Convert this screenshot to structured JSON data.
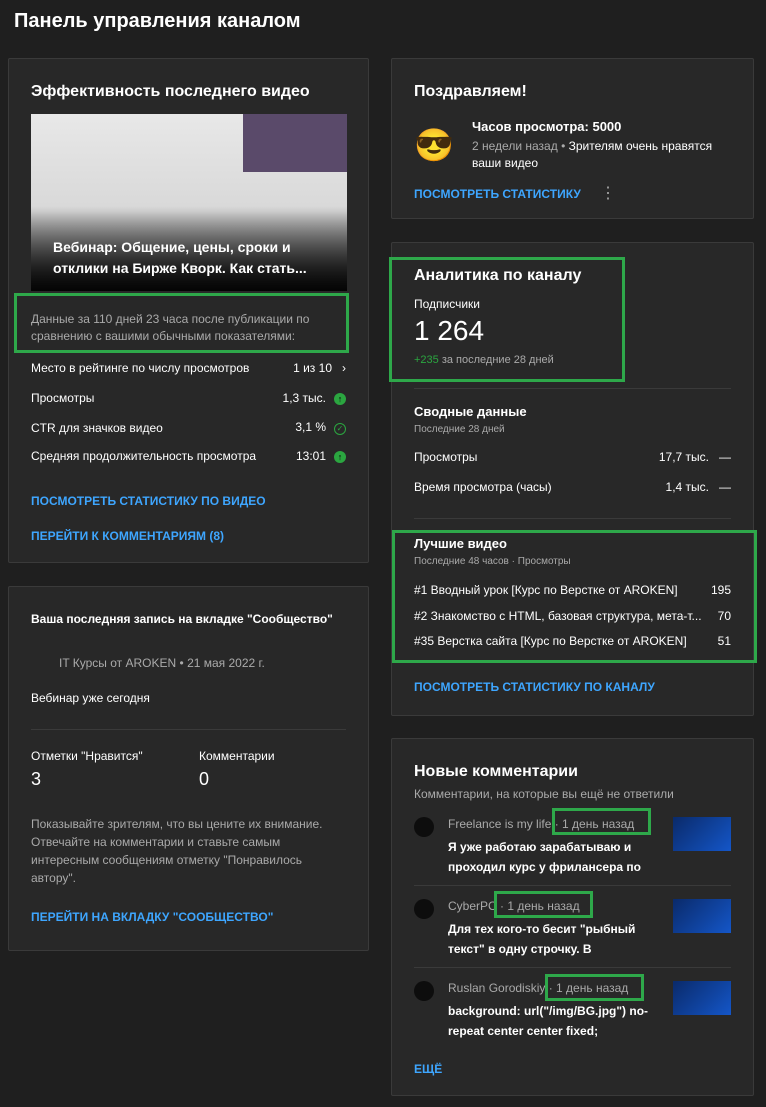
{
  "page_title": "Панель управления каналом",
  "last_video": {
    "heading": "Эффективность последнего видео",
    "video_title": "Вебинар: Общение, цены, сроки и отклики на Бирже Кворк. Как стать...",
    "note": "Данные за 110 дней 23 часа после публикации по сравнению с вашими обычными показателями:",
    "metrics": [
      {
        "label": "Место в рейтинге по числу просмотров",
        "value": "1 из 10"
      },
      {
        "label": "Просмотры",
        "value": "1,3 тыс."
      },
      {
        "label": "CTR для значков видео",
        "value": "3,1 %"
      },
      {
        "label": "Средняя продолжительность просмотра",
        "value": "13:01"
      }
    ],
    "link_stats": "ПОСМОТРЕТЬ СТАТИСТИКУ ПО ВИДЕО",
    "link_comments": "ПЕРЕЙТИ К КОММЕНТАРИЯМ (8)"
  },
  "community": {
    "heading": "Ваша последняя запись на вкладке \"Сообщество\"",
    "author": "IT Курсы от AROKEN",
    "date": "21 мая 2022 г.",
    "post": "Вебинар уже сегодня",
    "likes_label": "Отметки \"Нравится\"",
    "likes": "3",
    "comments_label": "Комментарии",
    "comments": "0",
    "tip": "Показывайте зрителям, что вы цените их внимание. Отвечайте на комментарии и ставьте самым интересным сообщениям отметку \"Понравилось автору\".",
    "link": "ПЕРЕЙТИ НА ВКЛАДКУ \"СООБЩЕСТВО\""
  },
  "congrats": {
    "heading": "Поздравляем!",
    "milestone": "Часов просмотра: 5000",
    "time": "2 недели назад",
    "text": "Зрителям очень нравятся ваши видео",
    "link": "ПОСМОТРЕТЬ СТАТИСТИКУ"
  },
  "analytics": {
    "heading": "Аналитика по каналу",
    "subs_label": "Подписчики",
    "subs": "1 264",
    "delta": "+235",
    "delta_text": "за последние 28 дней",
    "summary_heading": "Сводные данные",
    "summary_period": "Последние 28 дней",
    "summary": [
      {
        "label": "Просмотры",
        "value": "17,7 тыс.",
        "trend": "—"
      },
      {
        "label": "Время просмотра (часы)",
        "value": "1,4 тыс.",
        "trend": "—"
      }
    ],
    "top_heading": "Лучшие видео",
    "top_period": "Последние 48 часов · Просмотры",
    "top": [
      {
        "title": "#1 Вводный урок [Курс по Верстке от AROKEN]",
        "views": "195"
      },
      {
        "title": "#2 Знакомство с HTML, базовая структура, мета-т...",
        "views": "70"
      },
      {
        "title": "#35 Верстка сайта [Курс по Верстке от AROKEN]",
        "views": "51"
      }
    ],
    "link": "ПОСМОТРЕТЬ СТАТИСТИКУ ПО КАНАЛУ"
  },
  "comments": {
    "heading": "Новые комментарии",
    "subtitle": "Комментарии, на которые вы ещё не ответили",
    "items": [
      {
        "author": "Freelance is my life",
        "time": "1 день назад",
        "text": "Я уже работаю зарабатываю и проходил курс у фрилансера по ..."
      },
      {
        "author": "CyberPC",
        "time": "1 день назад",
        "text": "Для тех кого-то бесит \"рыбный текст\" в одну строчку. В настройках ищем ..."
      },
      {
        "author": "Ruslan Gorodiskiy",
        "time": "1 день назад",
        "text": "background: url(\"/img/BG.jpg\") no-repeat center center fixed; background..."
      }
    ],
    "more": "ЕЩЁ"
  }
}
